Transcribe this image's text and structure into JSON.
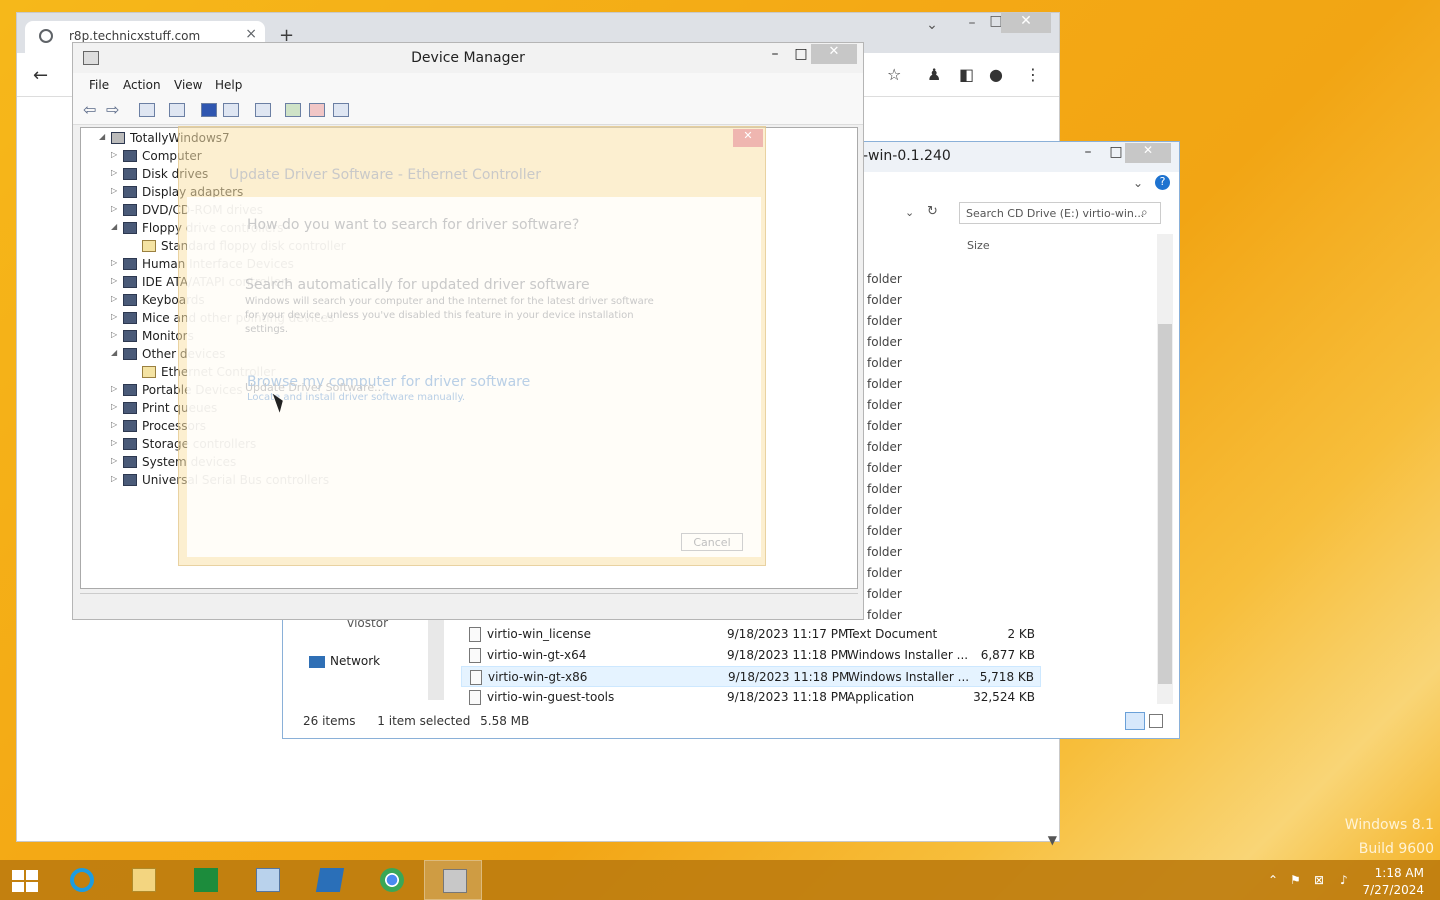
{
  "browser": {
    "tab_title": "r8p.technicxstuff.com",
    "new_tab": "+",
    "close_tab": "×"
  },
  "explorer": {
    "title": "-win-0.1.240",
    "search_placeholder": "Search CD Drive (E:) virtio-win...",
    "col_size": "Size",
    "folder_label": "folder",
    "nav_network": "Network",
    "nav_partial": "viostor",
    "files": [
      {
        "name": "virtio-win_license",
        "date": "9/18/2023 11:17 PM",
        "type": "Text Document",
        "size": "2 KB"
      },
      {
        "name": "virtio-win-gt-x64",
        "date": "9/18/2023 11:18 PM",
        "type": "Windows Installer ...",
        "size": "6,877 KB"
      },
      {
        "name": "virtio-win-gt-x86",
        "date": "9/18/2023 11:18 PM",
        "type": "Windows Installer ...",
        "size": "5,718 KB"
      },
      {
        "name": "virtio-win-guest-tools",
        "date": "9/18/2023 11:18 PM",
        "type": "Application",
        "size": "32,524 KB"
      }
    ],
    "status": {
      "items": "26 items",
      "selected": "1 item selected",
      "size": "5.58 MB"
    }
  },
  "device_manager": {
    "title": "Device Manager",
    "menu": [
      "File",
      "Action",
      "View",
      "Help"
    ],
    "root": "TotallyWindows7",
    "nodes": [
      {
        "label": "Computer",
        "arrow": "▷",
        "level": 1
      },
      {
        "label": "Disk drives",
        "arrow": "▷",
        "level": 1
      },
      {
        "label": "Display adapters",
        "arrow": "▷",
        "level": 1
      },
      {
        "label": "DVD/CD-ROM drives",
        "arrow": "▷",
        "level": 1
      },
      {
        "label": "Floppy drive controllers",
        "arrow": "◢",
        "level": 1
      },
      {
        "label": "Standard floppy disk controller",
        "arrow": "",
        "level": 2
      },
      {
        "label": "Human Interface Devices",
        "arrow": "▷",
        "level": 1
      },
      {
        "label": "IDE ATA/ATAPI controllers",
        "arrow": "▷",
        "level": 1
      },
      {
        "label": "Keyboards",
        "arrow": "▷",
        "level": 1
      },
      {
        "label": "Mice and other pointing devices",
        "arrow": "▷",
        "level": 1
      },
      {
        "label": "Monitors",
        "arrow": "▷",
        "level": 1
      },
      {
        "label": "Other devices",
        "arrow": "◢",
        "level": 1
      },
      {
        "label": "Ethernet Controller",
        "arrow": "",
        "level": 2
      },
      {
        "label": "Portable Devices",
        "arrow": "▷",
        "level": 1
      },
      {
        "label": "Print queues",
        "arrow": "▷",
        "level": 1
      },
      {
        "label": "Processors",
        "arrow": "▷",
        "level": 1
      },
      {
        "label": "Storage controllers",
        "arrow": "▷",
        "level": 1
      },
      {
        "label": "System devices",
        "arrow": "▷",
        "level": 1
      },
      {
        "label": "Universal Serial Bus controllers",
        "arrow": "▷",
        "level": 1
      }
    ]
  },
  "dialog": {
    "title": "Update Driver Software - Ethernet Controller",
    "question": "How do you want to search for driver software?",
    "auto_title": "Search automatically for updated driver software",
    "auto_desc1": "Windows will search your computer and the Internet for the latest driver software",
    "auto_desc2": "for your device, unless you've disabled this feature in your device installation",
    "auto_desc3": "settings.",
    "browse_title": "Browse my computer for driver software",
    "browse_desc": "Locate and install driver software manually.",
    "context_menu": "Update Driver Software...",
    "cancel": "Cancel"
  },
  "desktop": {
    "watermark_line1": "Windows 8.1",
    "watermark_line2": "Build 9600"
  },
  "taskbar": {
    "time": "1:18 AM",
    "date": "7/27/2024"
  }
}
